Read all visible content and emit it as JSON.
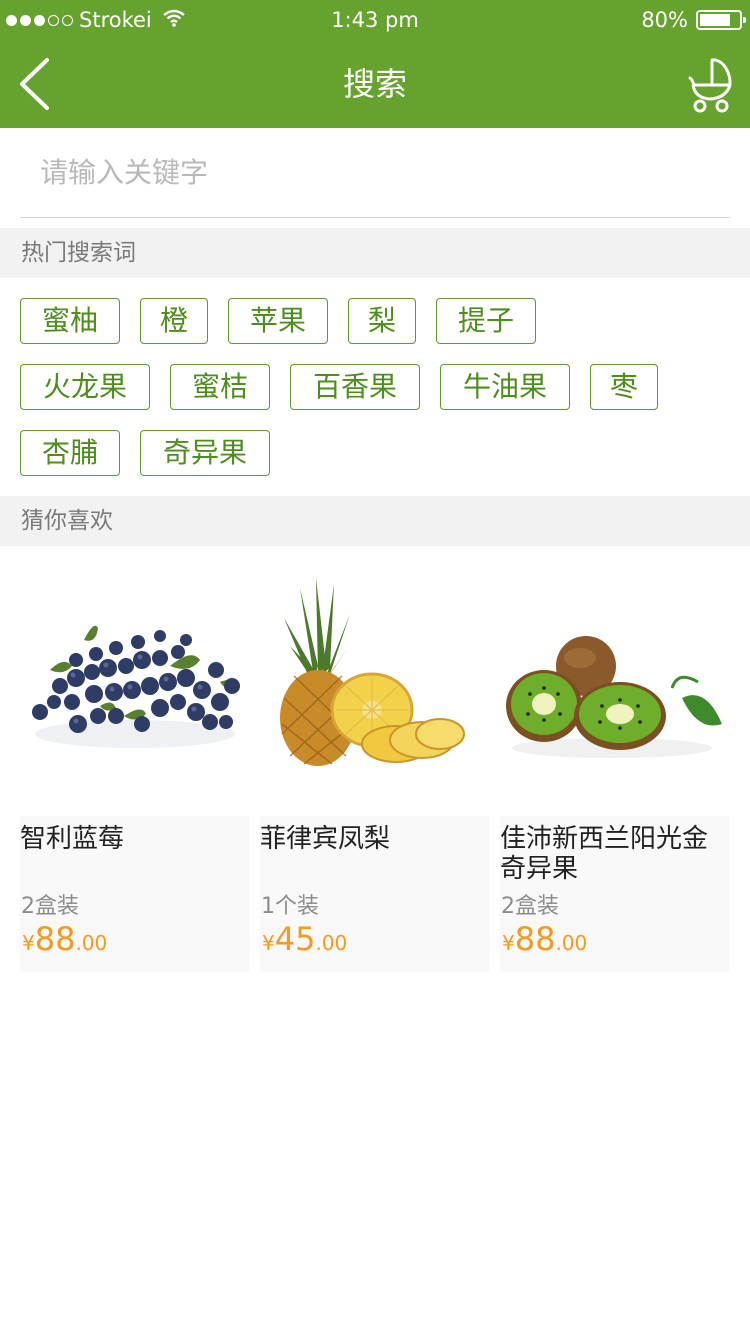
{
  "status_bar": {
    "carrier": "Strokei",
    "time": "1:43 pm",
    "battery": "80%",
    "battery_level": 0.8
  },
  "nav": {
    "title": "搜索",
    "back_icon": "chevron-left-icon",
    "cart_icon": "stroller-cart-icon"
  },
  "search": {
    "placeholder": "请输入关键字",
    "value": ""
  },
  "hot": {
    "title": "热门搜索词",
    "tags": [
      "蜜柚",
      "橙",
      "苹果",
      "梨",
      "提子",
      "火龙果",
      "蜜桔",
      "百香果",
      "牛油果",
      "枣",
      "杏脯",
      "奇异果"
    ]
  },
  "recommend": {
    "title": "猜你喜欢",
    "products": [
      {
        "name": "智利蓝莓",
        "spec": "2盒装",
        "currency": "¥",
        "price_int": "88",
        "price_dec": ".00",
        "image": "blueberries"
      },
      {
        "name": "菲律宾凤梨",
        "spec": "1个装",
        "currency": "¥",
        "price_int": "45",
        "price_dec": ".00",
        "image": "pineapple"
      },
      {
        "name": "佳沛新西兰阳光金奇异果",
        "spec": "2盒装",
        "currency": "¥",
        "price_int": "88",
        "price_dec": ".00",
        "image": "kiwi"
      }
    ]
  },
  "colors": {
    "brand_green": "#66a22e",
    "tag_green": "#4f8d1f",
    "price_orange": "#f39a1f"
  }
}
